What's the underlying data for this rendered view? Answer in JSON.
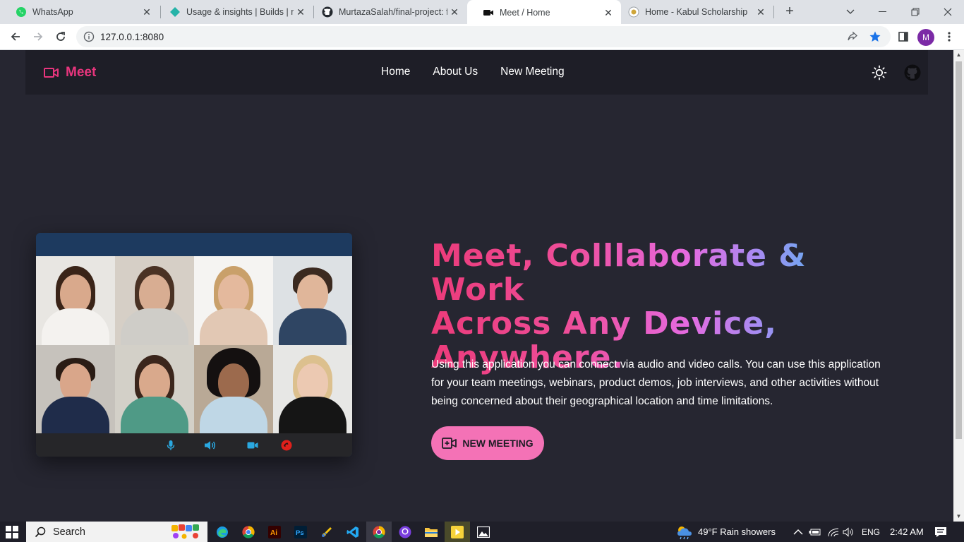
{
  "browser": {
    "tabs": [
      {
        "title": "WhatsApp",
        "icon": "whatsapp-icon"
      },
      {
        "title": "Usage & insights | Builds | m",
        "icon": "netlify-icon"
      },
      {
        "title": "MurtazaSalah/final-project: f",
        "icon": "github-icon"
      },
      {
        "title": "Meet / Home",
        "icon": "meet-video-icon",
        "active": true
      },
      {
        "title": "Home - Kabul Scholarship",
        "icon": "scholarship-icon"
      }
    ],
    "url": "127.0.0.1:8080",
    "profile_initial": "M"
  },
  "site": {
    "logo": "Meet",
    "nav": [
      "Home",
      "About Us",
      "New Meeting"
    ],
    "hero": {
      "title_line1": "Meet, Colllaborate & Work",
      "title_line2": "Across Any Device,",
      "title_line3": "Anywhere.",
      "description": "Using this application you can connect via audio and video calls. You can use this application for your team meetings, webinars, product demos, job interviews, and other activities without being concerned about their geographical location and time limitations.",
      "cta_label": "NEW MEETING"
    },
    "colors": {
      "accent": "#e8357d",
      "cta": "#f472b6",
      "background": "#262631",
      "nav": "#1e1e27"
    }
  },
  "taskbar": {
    "search_label": "Search",
    "weather": "49°F  Rain showers",
    "language": "ENG",
    "time": "2:42 AM"
  }
}
